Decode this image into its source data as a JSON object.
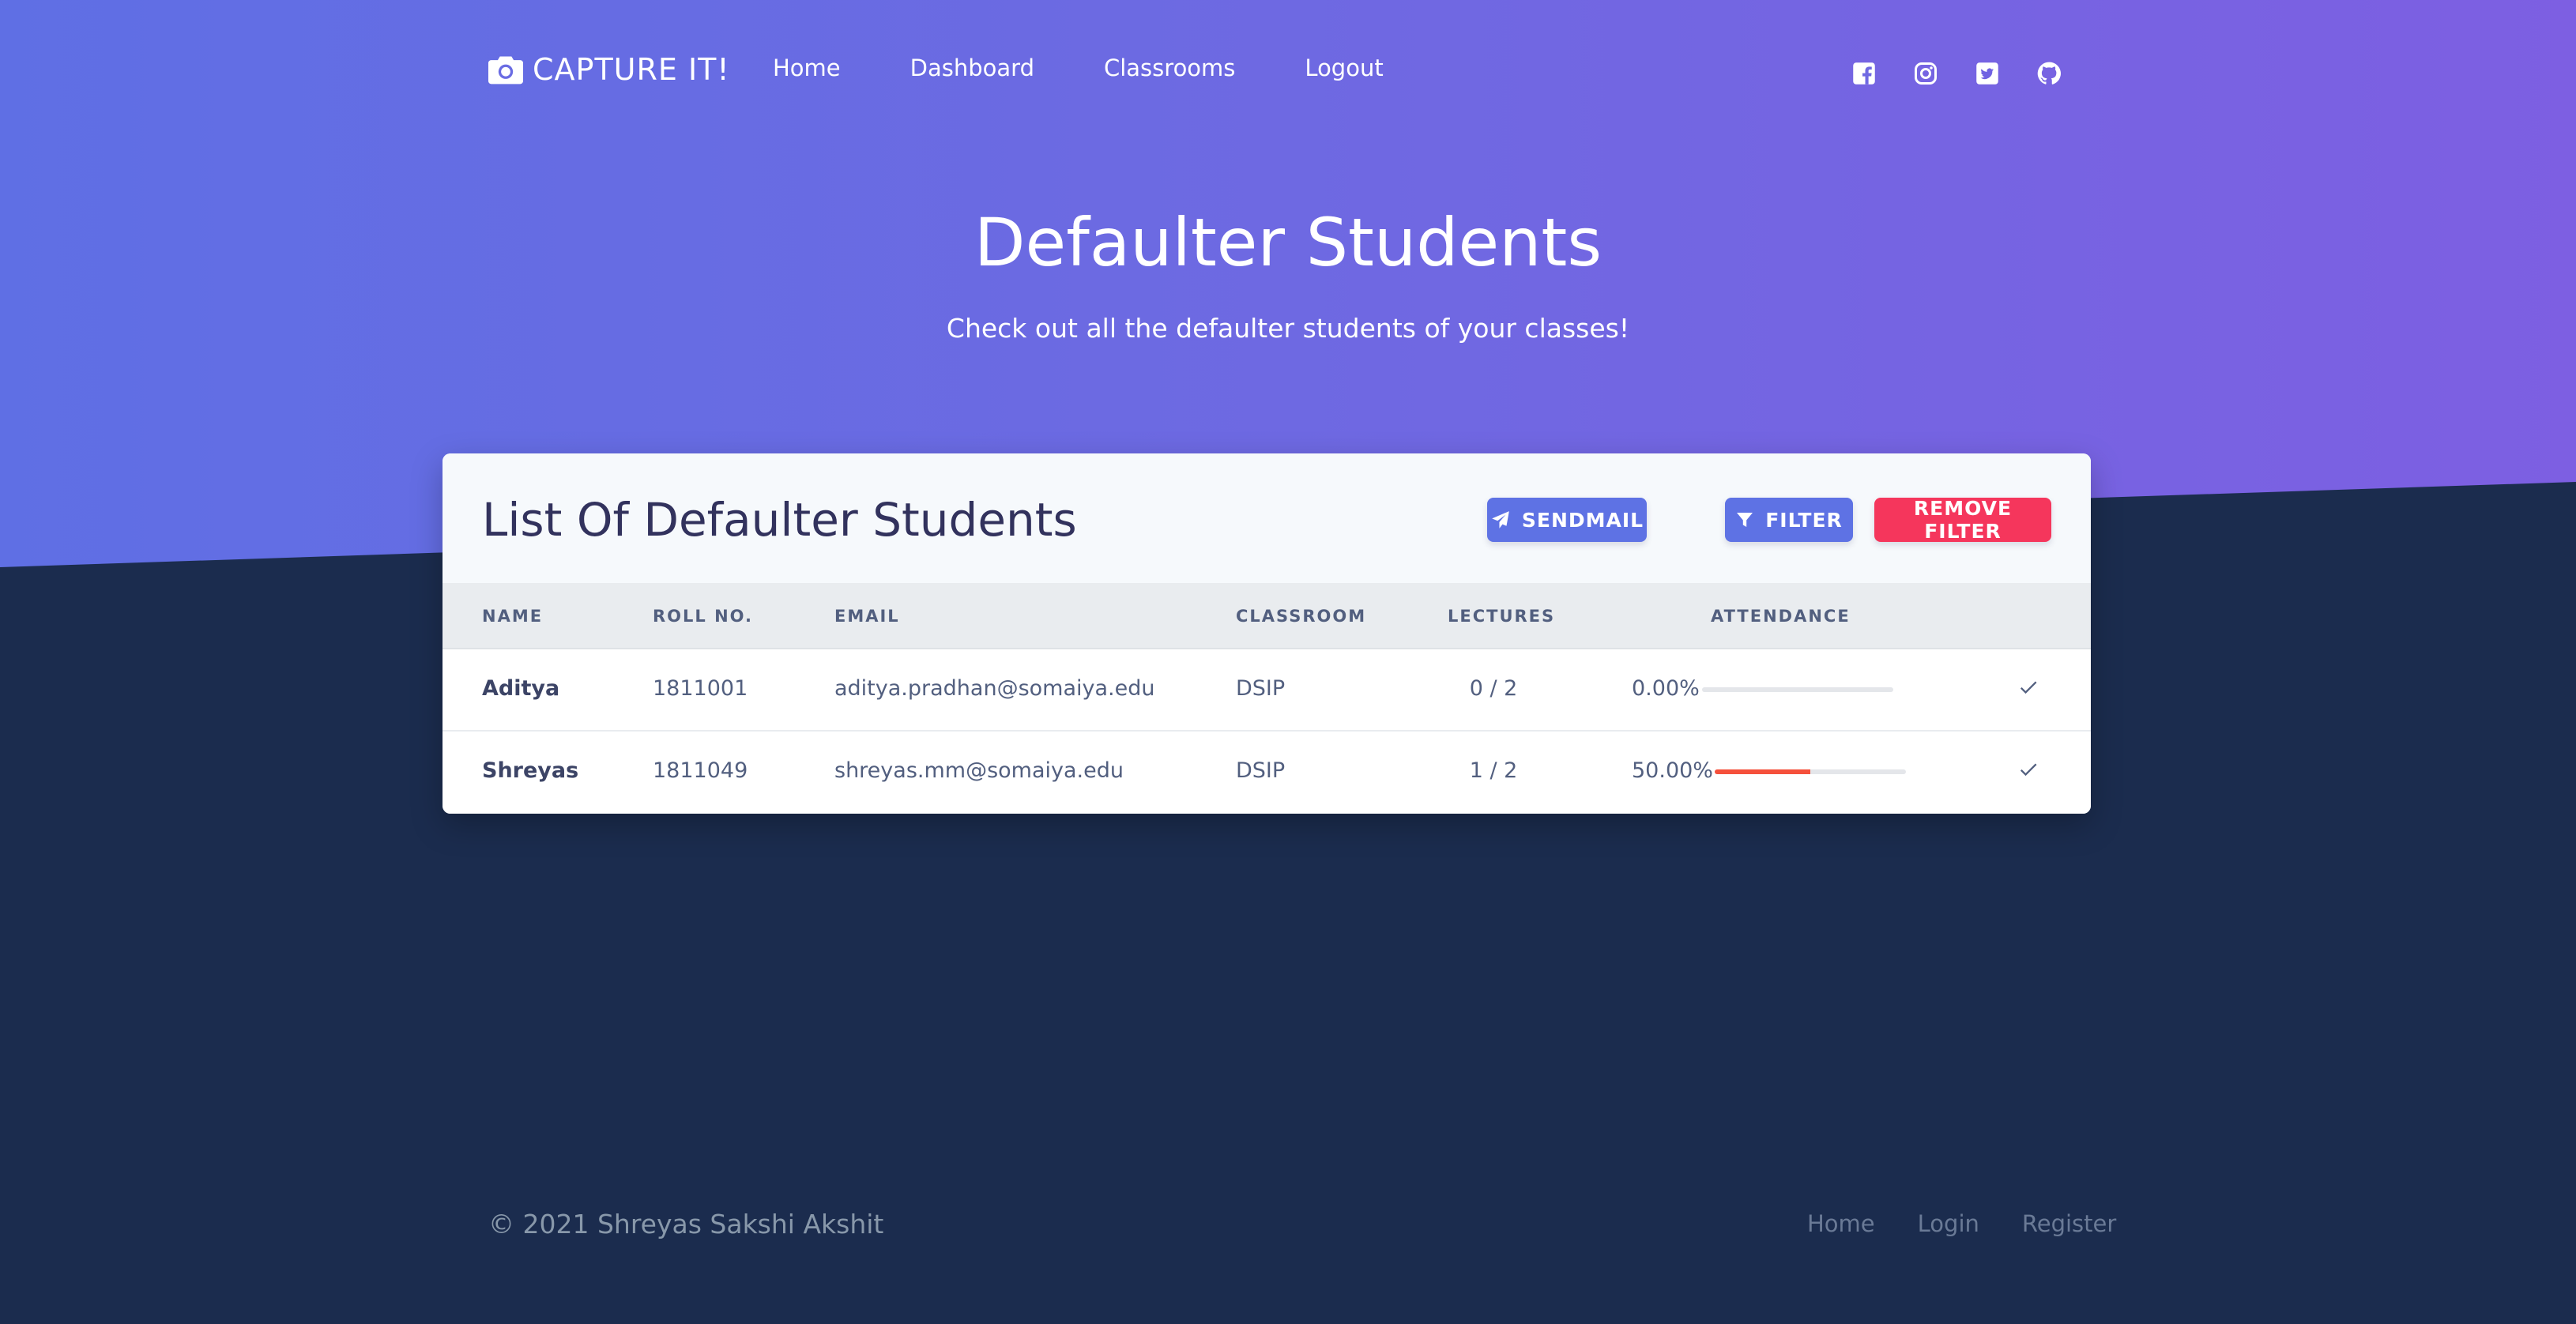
{
  "navbar": {
    "brand": "CAPTURE IT!",
    "brand_icon": "camera-icon",
    "links": [
      "Home",
      "Dashboard",
      "Classrooms",
      "Logout"
    ],
    "social_icons": [
      "facebook-icon",
      "instagram-icon",
      "twitter-icon",
      "github-icon"
    ]
  },
  "hero": {
    "title": "Defaulter Students",
    "subtitle": "Check out all the defaulter students of your classes!"
  },
  "card": {
    "title": "List Of Defaulter Students",
    "sendmail_label": "SENDMAIL",
    "filter_label": "FILTER",
    "remove_filter_label": "REMOVE FILTER",
    "columns": [
      "NAME",
      "ROLL NO.",
      "EMAIL",
      "CLASSROOM",
      "LECTURES",
      "ATTENDANCE"
    ],
    "rows": [
      {
        "name": "Aditya",
        "roll": "1811001",
        "email": "aditya.pradhan@somaiya.edu",
        "classroom": "DSIP",
        "lectures": "0 / 2",
        "attendance": "0.00%",
        "attendance_fraction": 0.0
      },
      {
        "name": "Shreyas",
        "roll": "1811049",
        "email": "shreyas.mm@somaiya.edu",
        "classroom": "DSIP",
        "lectures": "1 / 2",
        "attendance": "50.00%",
        "attendance_fraction": 0.5
      }
    ]
  },
  "footer": {
    "copyright": "© 2021 Shreyas Sakshi Akshit",
    "links": [
      "Home",
      "Login",
      "Register"
    ]
  },
  "colors": {
    "primary": "#5e72e4",
    "danger": "#f5365c",
    "progress": "#f5503b",
    "dark_bg": "#1b2c4e"
  }
}
